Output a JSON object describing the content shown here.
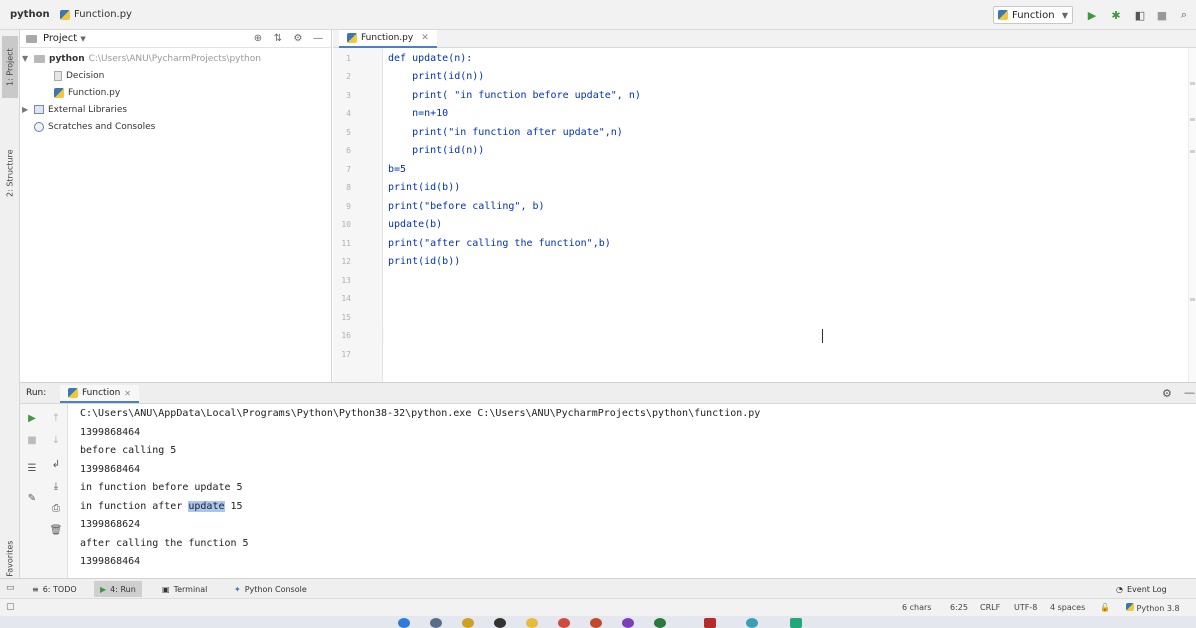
{
  "navbar": {
    "project": "python",
    "file": "Function.py",
    "run_config": "Function"
  },
  "left_strip": {
    "project_tab": "1: Project",
    "structure_tab": "2: Structure",
    "favorites_tab": "2: Favorites"
  },
  "project_panel": {
    "title": "Project",
    "root_name": "python",
    "root_path": "C:\\Users\\ANU\\PycharmProjects\\python",
    "items": [
      "Decision",
      "Function.py",
      "External Libraries",
      "Scratches and Consoles"
    ]
  },
  "editor": {
    "tab": "Function.py",
    "line_numbers": [
      "1",
      "2",
      "3",
      "4",
      "5",
      "6",
      "7",
      "8",
      "9",
      "10",
      "11",
      "12",
      "13",
      "14",
      "15",
      "16",
      "17"
    ],
    "lines": [
      "def update(n):",
      "    print(id(n))",
      "    print( \"in function before update\", n)",
      "    n=n+10",
      "    print(\"in function after update\",n)",
      "    print(id(n))",
      "b=5",
      "print(id(b))",
      "print(\"before calling\", b)",
      "update(b)",
      "print(\"after calling the function\",b)",
      "print(id(b))"
    ]
  },
  "run_window": {
    "label": "Run:",
    "tab": "Function",
    "console": {
      "command": "C:\\Users\\ANU\\AppData\\Local\\Programs\\Python\\Python38-32\\python.exe C:\\Users\\ANU\\PycharmProjects\\python\\function.py",
      "out1": "1399868464",
      "out2": "before calling 5",
      "out3": "1399868464",
      "out4": "in function before update 5",
      "out5_pre": "in function after ",
      "out5_hl": "update",
      "out5_post": " 15",
      "out6": "1399868624",
      "out7": "after calling the function 5",
      "out8": "1399868464"
    }
  },
  "bottom_tabs": {
    "todo": "6: TODO",
    "run": "4: Run",
    "terminal": "Terminal",
    "python_console": "Python Console",
    "event_log": "Event Log"
  },
  "status": {
    "chars": "6 chars",
    "position": "6:25",
    "line_sep": "CRLF",
    "encoding": "UTF-8",
    "indent": "4 spaces",
    "interpreter": "Python 3.8"
  },
  "colors": {
    "accent": "#4d7fc6",
    "code_text": "#0033b3",
    "run_green": "#3c9a3c",
    "selection": "#a7c7f2"
  }
}
